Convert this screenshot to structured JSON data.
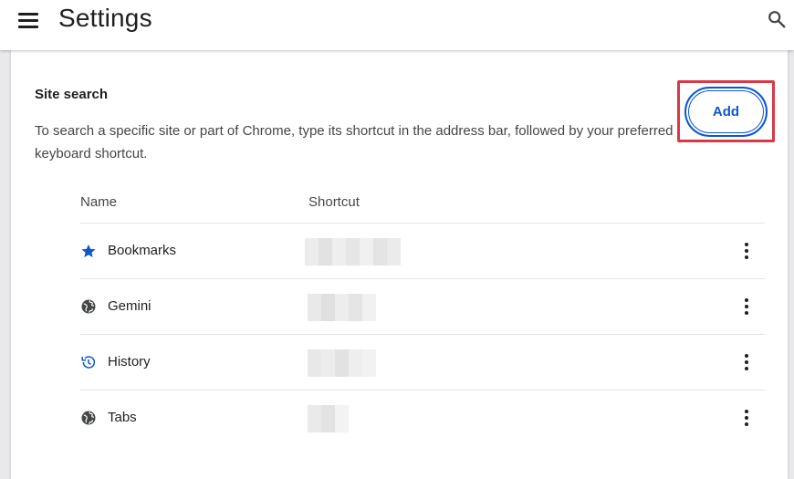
{
  "header": {
    "title": "Settings",
    "menu_icon": "hamburger-menu-icon",
    "search_icon": "search-icon"
  },
  "site_search": {
    "title": "Site search",
    "description": "To search a specific site or part of Chrome, type its shortcut in the address bar, followed by your preferred keyboard shortcut.",
    "add_label": "Add"
  },
  "table": {
    "columns": [
      "Name",
      "Shortcut"
    ],
    "rows": [
      {
        "name": "Bookmarks",
        "icon": "star-icon"
      },
      {
        "name": "Gemini",
        "icon": "globe-icon"
      },
      {
        "name": "History",
        "icon": "history-icon"
      },
      {
        "name": "Tabs",
        "icon": "globe-icon"
      }
    ]
  },
  "colors": {
    "accent": "#0b57d0",
    "highlight": "#d93844",
    "page_bg": "#e9e9ec"
  }
}
